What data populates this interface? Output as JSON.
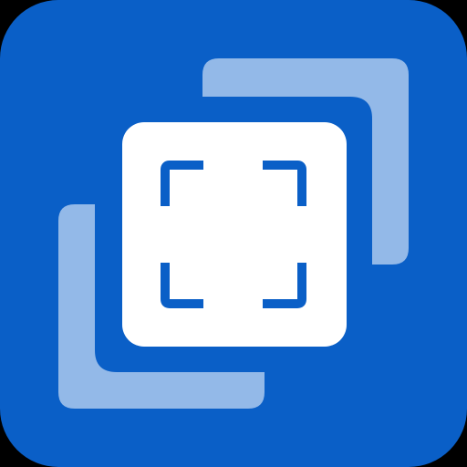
{
  "app_icon": {
    "icon_name": "screen-capture-icon",
    "colors": {
      "background": "#000000",
      "tile": "#0A5FC7",
      "layer_light": "#93B9E8",
      "frame_panel": "#FFFFFF",
      "corner_brackets": "#0A5FC7"
    }
  }
}
